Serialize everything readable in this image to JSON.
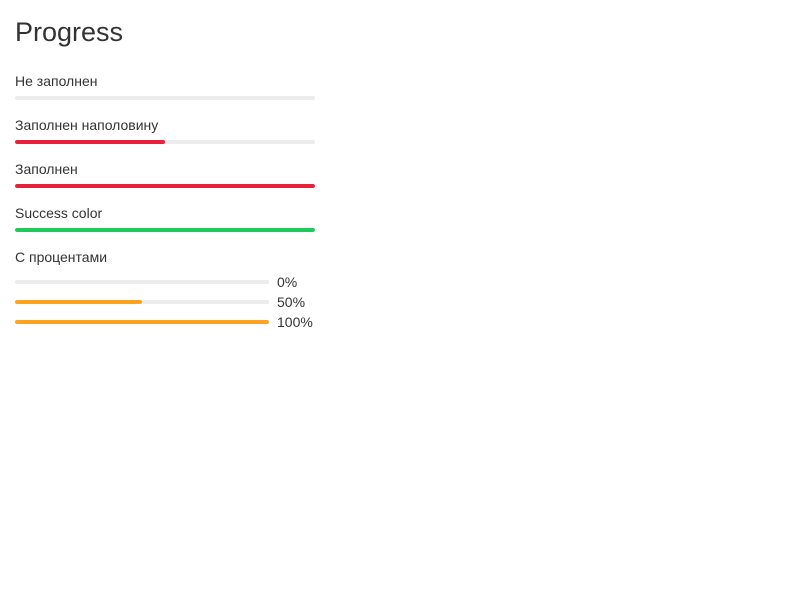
{
  "title": "Progress",
  "colors": {
    "track": "#ececec",
    "danger": "#e8203a",
    "success": "#1ecb5a",
    "warning": "#ffa21f"
  },
  "bars": [
    {
      "label": "Не заполнен",
      "value": 0,
      "color": "#e8203a"
    },
    {
      "label": "Заполнен наполовину",
      "value": 50,
      "color": "#e8203a"
    },
    {
      "label": "Заполнен",
      "value": 100,
      "color": "#e8203a"
    },
    {
      "label": "Success color",
      "value": 100,
      "color": "#1ecb5a"
    }
  ],
  "percent_section": {
    "label": "С процентами",
    "color": "#ffa21f",
    "items": [
      {
        "value": 0,
        "text": "0%"
      },
      {
        "value": 50,
        "text": "50%"
      },
      {
        "value": 100,
        "text": "100%"
      }
    ]
  }
}
